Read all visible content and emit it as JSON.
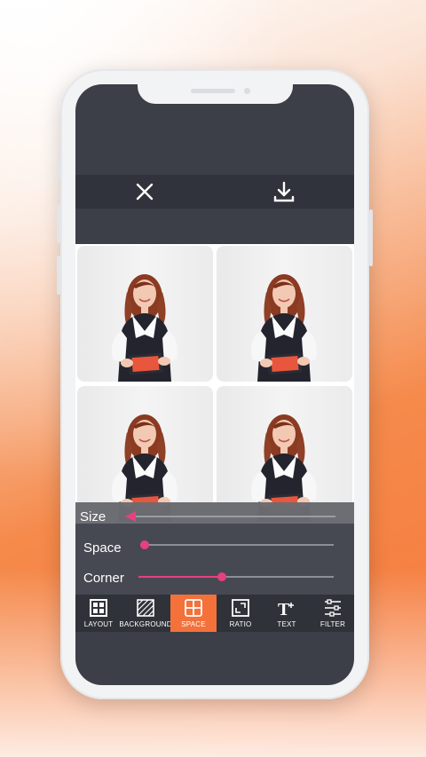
{
  "header": {
    "close_icon": "close-icon",
    "download_icon": "download-icon"
  },
  "sliders": [
    {
      "label": "Size",
      "value": 0.0
    },
    {
      "label": "Space",
      "value": 0.03
    },
    {
      "label": "Corner",
      "value": 0.43
    }
  ],
  "toolbar": {
    "items": [
      {
        "label": "LAYOUT",
        "icon": "layout-icon"
      },
      {
        "label": "BACKGROUND",
        "icon": "background-icon"
      },
      {
        "label": "SPACE",
        "icon": "space-icon",
        "active": true
      },
      {
        "label": "RATIO",
        "icon": "ratio-icon"
      },
      {
        "label": "TEXT",
        "icon": "text-icon"
      },
      {
        "label": "FILTER",
        "icon": "filter-icon"
      }
    ]
  },
  "colors": {
    "accent": "#e8407f",
    "active_tab": "#f4713a",
    "screen_bg": "#3c3f48"
  }
}
